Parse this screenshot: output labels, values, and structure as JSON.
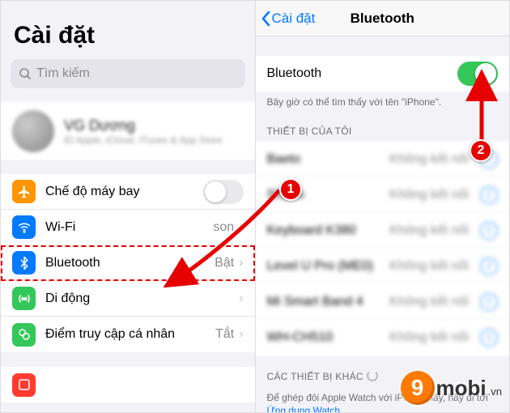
{
  "left": {
    "title": "Cài đặt",
    "search_placeholder": "Tìm kiếm",
    "profile": {
      "name": "VG Dương",
      "sub": "ID Apple, iCloud, iTunes & App Store"
    },
    "rows": {
      "airplane": {
        "label": "Chế độ máy bay"
      },
      "wifi": {
        "label": "Wi-Fi",
        "value": "son"
      },
      "bluetooth": {
        "label": "Bluetooth",
        "value": "Bật"
      },
      "cellular": {
        "label": "Di động"
      },
      "hotspot": {
        "label": "Điểm truy cập cá nhân",
        "value": "Tắt"
      }
    }
  },
  "right": {
    "back": "Cài đặt",
    "title": "Bluetooth",
    "toggle_label": "Bluetooth",
    "discover_note": "Bây giờ có thể tìm thấy với tên \"iPhone\".",
    "my_devices_header": "THIẾT BỊ CỦA TÔI",
    "status_not_connected": "Không kết nối",
    "other_devices_header": "CÁC THIẾT BỊ KHÁC",
    "pair_note": "Để ghép đôi Apple Watch với iPhone này, hãy đi tới",
    "pair_link": "Ứng dụng Watch.",
    "devices": [
      {
        "name": "Baeto"
      },
      {
        "name": "Shaho"
      },
      {
        "name": "Keyboard K380"
      },
      {
        "name": "Level U Pro (ME0)"
      },
      {
        "name": "Mi Smart Band 4"
      },
      {
        "name": "WH-CH510"
      }
    ]
  },
  "annotations": {
    "badge1": "1",
    "badge2": "2",
    "logo_text": "mobi",
    "logo_vn": ".vn"
  },
  "colors": {
    "airplane": "#ff9500",
    "wifi": "#007aff",
    "bluetooth": "#007aff",
    "cellular": "#34c759",
    "hotspot": "#34c759",
    "red": "#ff3b30"
  }
}
